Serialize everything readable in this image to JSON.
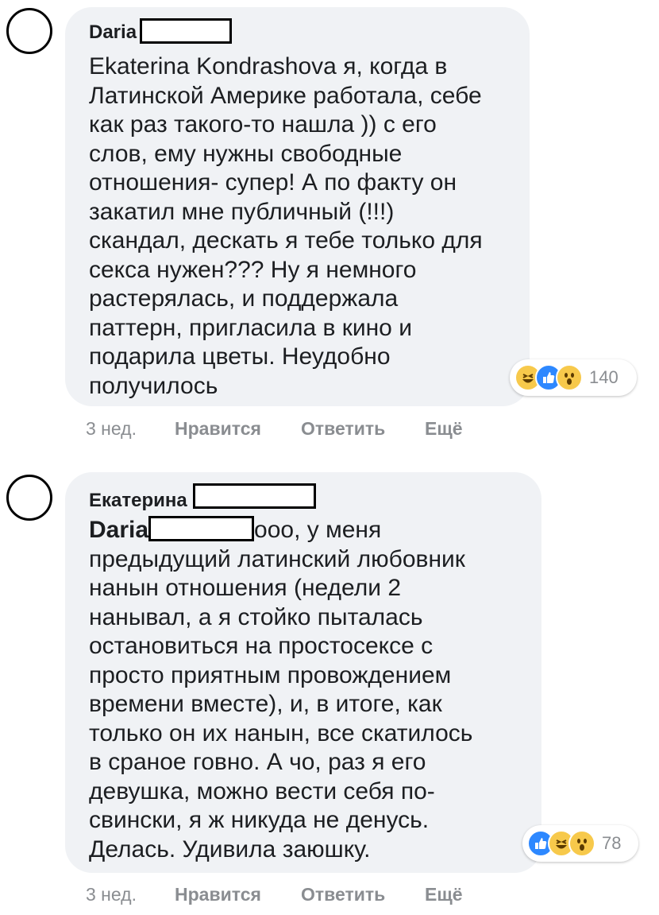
{
  "comments": [
    {
      "author": "Daria",
      "lines": [
        "Ekaterina Kondrashova я, когда в",
        "Латинской Америке работала, себе",
        "как раз такого-то нашла )) с его",
        "слов, ему нужны свободные",
        "отношения- супер! А по факту он",
        "закатил мне публичный (!!!)",
        "скандал, дескать я тебе только для",
        "секса нужен??? Ну я немного",
        "растерялась, и поддержала",
        "паттерн, пригласила в кино и",
        "подарила цветы. Неудобно",
        "получилось"
      ],
      "reactions": [
        "haha-icon",
        "like-icon",
        "wow-icon"
      ],
      "reaction_count": "140",
      "time": "3 нед.",
      "like_label": "Нравится",
      "reply_label": "Ответить",
      "more_label": "Ещё"
    },
    {
      "author": "Екатерина",
      "mention": "Daria",
      "first_line_rest": "ооо, у меня",
      "lines": [
        "предыдущий латинский любовник",
        "нанын отношения (недели 2",
        "нанывал, а я стойко пыталась",
        "остановиться на простосексе с",
        "просто приятным провождением",
        "времени вместе), и, в итоге, как",
        "только он их нанын, все скатилось",
        "в сраное говно. А чо, раз я его",
        "девушка, можно вести себя по-",
        "свински, я ж никуда не денусь.",
        "Делась. Удивила заюшку."
      ],
      "reactions": [
        "like-icon",
        "haha-icon",
        "wow-icon"
      ],
      "reaction_count": "78",
      "time": "3 нед.",
      "like_label": "Нравится",
      "reply_label": "Ответить",
      "more_label": "Ещё"
    }
  ]
}
